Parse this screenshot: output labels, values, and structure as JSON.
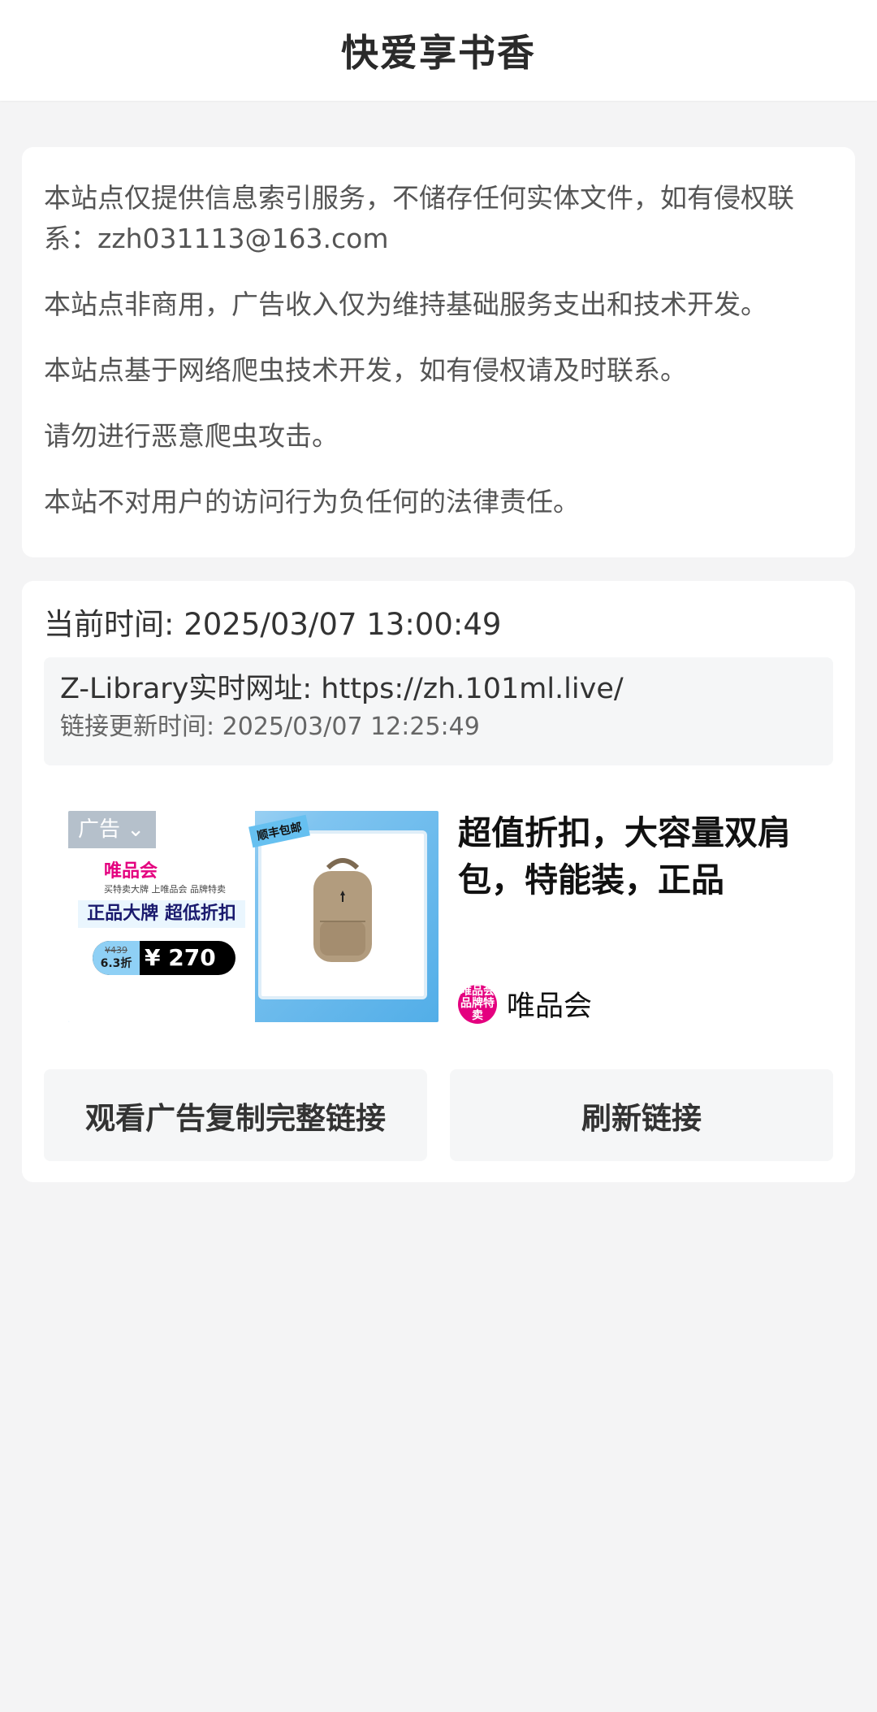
{
  "header": {
    "title": "快爱享书香"
  },
  "notice": {
    "lines": [
      "本站点仅提供信息索引服务，不储存任何实体文件，如有侵权联系：zzh031113@163.com",
      "本站点非商用，广告收入仅为维持基础服务支出和技术开发。",
      "本站点基于网络爬虫技术开发，如有侵权请及时联系。",
      "请勿进行恶意爬虫攻击。",
      "本站不对用户的访问行为负任何的法律责任。"
    ]
  },
  "link_info": {
    "current_time": "当前时间: 2025/03/07 13:00:49",
    "url_line": "Z-Library实时网址: https://zh.101ml.live/",
    "updated_line": "链接更新时间: 2025/03/07 12:25:49"
  },
  "ad": {
    "tag": "广告 ⌄",
    "sticker": "顺丰包邮",
    "image_brand": "唯品会",
    "image_small_text": "买特卖大牌 上唯品会 品牌特卖",
    "image_headline": "正品大牌 超低折扣",
    "image_old_price": "¥439",
    "image_discount": "6.3折",
    "image_price": "¥ 270",
    "title": "超值折扣，大容量双肩包，特能装，正品",
    "advertiser": "唯品会",
    "logo_text": "唯品会 品牌特卖",
    "brand_color": "#e4007f"
  },
  "buttons": {
    "watch_ad": "观看广告复制完整链接",
    "refresh": "刷新链接"
  }
}
